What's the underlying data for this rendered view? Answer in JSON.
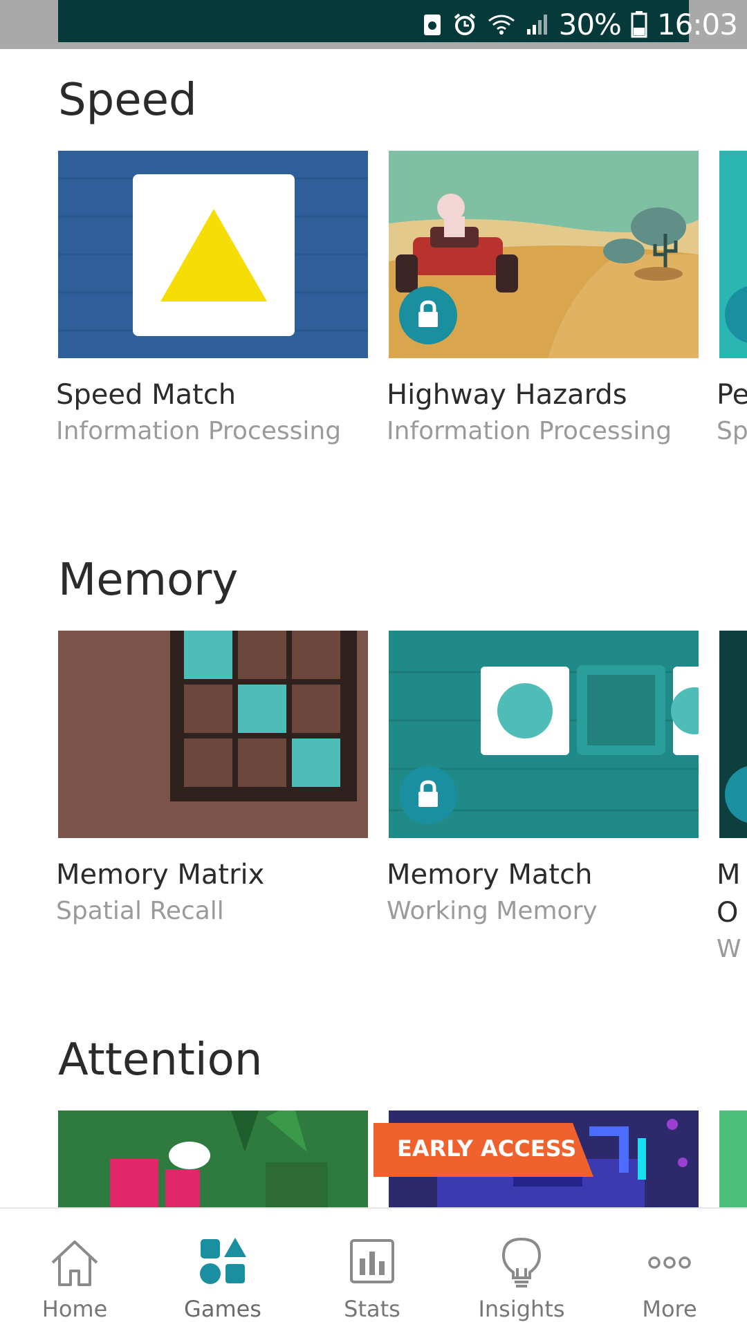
{
  "status_bar": {
    "battery": "30%",
    "time": "16:03"
  },
  "sections": {
    "speed": {
      "title": "Speed",
      "cards": [
        {
          "title": "Speed Match",
          "subtitle": "Information Processing",
          "locked": false
        },
        {
          "title": "Highway Hazards",
          "subtitle": "Information Processing",
          "locked": true
        },
        {
          "title": "Pe",
          "subtitle": "Sp",
          "locked": true
        }
      ]
    },
    "memory": {
      "title": "Memory",
      "cards": [
        {
          "title": "Memory Matrix",
          "subtitle": "Spatial Recall",
          "locked": false
        },
        {
          "title": "Memory Match",
          "subtitle": "Working Memory",
          "locked": true
        },
        {
          "title": "M",
          "title2": "O",
          "subtitle": "W",
          "locked": true
        }
      ]
    },
    "attention": {
      "title": "Attention",
      "badge": "EARLY ACCESS"
    }
  },
  "bottom_nav": {
    "items": [
      {
        "label": "Home",
        "icon": "home-icon"
      },
      {
        "label": "Games",
        "icon": "games-icon",
        "active": true
      },
      {
        "label": "Stats",
        "icon": "stats-icon"
      },
      {
        "label": "Insights",
        "icon": "insights-icon"
      },
      {
        "label": "More",
        "icon": "more-icon"
      }
    ]
  },
  "colors": {
    "accent": "#1a8fa0",
    "badge": "#f0622d",
    "active_nav": "#1a8fa0",
    "inactive_nav": "#777777"
  }
}
